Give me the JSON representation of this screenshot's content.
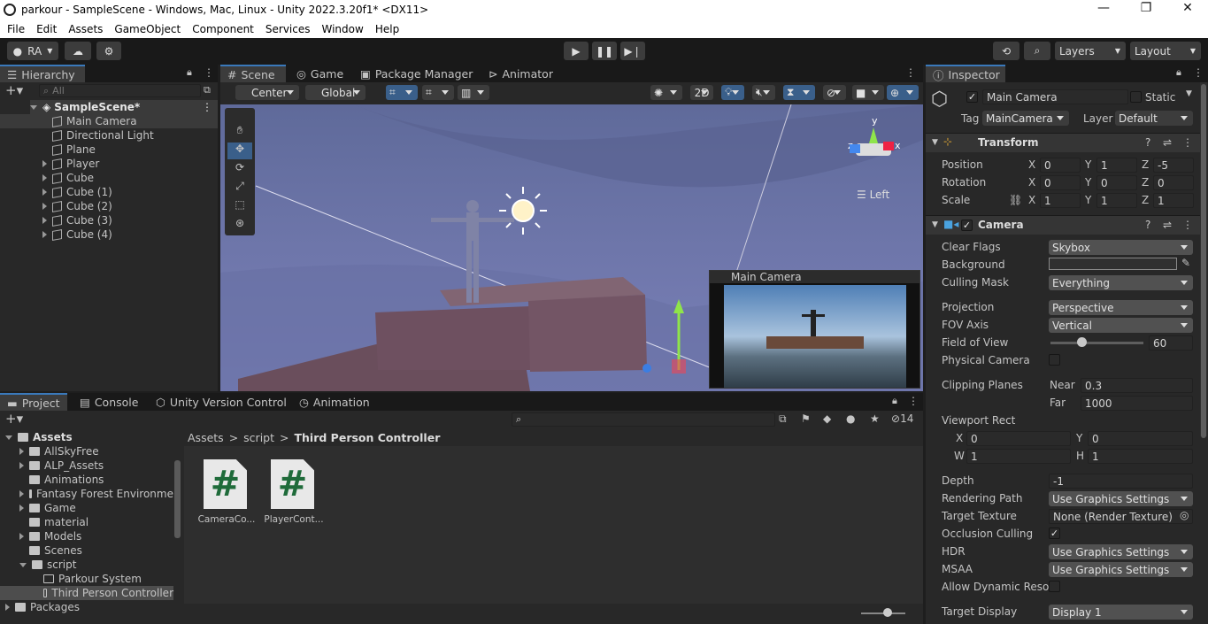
{
  "title": "parkour - SampleScene - Windows, Mac, Linux - Unity 2022.3.20f1* <DX11>",
  "window_controls": [
    "—",
    "❐",
    "✕"
  ],
  "menu": [
    "File",
    "Edit",
    "Assets",
    "GameObject",
    "Component",
    "Services",
    "Window",
    "Help"
  ],
  "toolbar": {
    "account": "RA",
    "layers": "Layers",
    "layout": "Layout"
  },
  "hierarchy": {
    "tab": "Hierarchy",
    "search_placeholder": "All",
    "scene": "SampleScene*",
    "items": [
      "Main Camera",
      "Directional Light",
      "Plane",
      "Player",
      "Cube",
      "Cube (1)",
      "Cube (2)",
      "Cube (3)",
      "Cube (4)"
    ]
  },
  "scene_tabs": [
    "Scene",
    "Game",
    "Package Manager",
    "Animator"
  ],
  "scene_toolbar": {
    "pivot": "Center",
    "space": "Global",
    "mode2d": "2D"
  },
  "gizmo": {
    "y": "y",
    "z": "z",
    "x": "x",
    "view": "Left"
  },
  "camera_preview": {
    "title": "Main Camera"
  },
  "bottom_tabs": [
    "Project",
    "Console",
    "Unity Version Control",
    "Animation"
  ],
  "project": {
    "count": "14",
    "tree": [
      {
        "label": "Assets",
        "level": 0,
        "open": true,
        "bold": true
      },
      {
        "label": "AllSkyFree",
        "level": 1
      },
      {
        "label": "ALP_Assets",
        "level": 1
      },
      {
        "label": "Animations",
        "level": 1,
        "noarrow": true
      },
      {
        "label": "Fantasy Forest Environme",
        "level": 1
      },
      {
        "label": "Game",
        "level": 1
      },
      {
        "label": "material",
        "level": 1,
        "noarrow": true
      },
      {
        "label": "Models",
        "level": 1
      },
      {
        "label": "Scenes",
        "level": 1,
        "noarrow": true
      },
      {
        "label": "script",
        "level": 1,
        "open": true
      },
      {
        "label": "Parkour System",
        "level": 2,
        "noarrow": true
      },
      {
        "label": "Third Person Controller",
        "level": 2,
        "noarrow": true,
        "selected": true
      },
      {
        "label": "Packages",
        "level": 0
      }
    ],
    "breadcrumb": [
      "Assets",
      "script",
      "Third Person Controller"
    ],
    "files": [
      {
        "name": "CameraCo...",
        "glyph": "#"
      },
      {
        "name": "PlayerCont...",
        "glyph": "#"
      }
    ]
  },
  "inspector": {
    "tab": "Inspector",
    "object_name": "Main Camera",
    "static_label": "Static",
    "tag_label": "Tag",
    "tag": "MainCamera",
    "layer_label": "Layer",
    "layer": "Default",
    "transform": {
      "title": "Transform",
      "position": {
        "label": "Position",
        "x": "0",
        "y": "1",
        "z": "-5"
      },
      "rotation": {
        "label": "Rotation",
        "x": "0",
        "y": "0",
        "z": "0"
      },
      "scale": {
        "label": "Scale",
        "x": "1",
        "y": "1",
        "z": "1"
      }
    },
    "camera": {
      "title": "Camera",
      "clear_flags": {
        "label": "Clear Flags",
        "value": "Skybox"
      },
      "background": {
        "label": "Background"
      },
      "culling_mask": {
        "label": "Culling Mask",
        "value": "Everything"
      },
      "projection": {
        "label": "Projection",
        "value": "Perspective"
      },
      "fov_axis": {
        "label": "FOV Axis",
        "value": "Vertical"
      },
      "fov": {
        "label": "Field of View",
        "value": "60",
        "fraction": 0.33
      },
      "physical": {
        "label": "Physical Camera"
      },
      "clipping": {
        "label": "Clipping Planes",
        "near_label": "Near",
        "near": "0.3",
        "far_label": "Far",
        "far": "1000"
      },
      "viewport": {
        "label": "Viewport Rect",
        "x": "0",
        "y": "0",
        "w": "1",
        "h": "1"
      },
      "depth": {
        "label": "Depth",
        "value": "-1"
      },
      "rendering_path": {
        "label": "Rendering Path",
        "value": "Use Graphics Settings"
      },
      "target_texture": {
        "label": "Target Texture",
        "value": "None (Render Texture)"
      },
      "occlusion": {
        "label": "Occlusion Culling"
      },
      "hdr": {
        "label": "HDR",
        "value": "Use Graphics Settings"
      },
      "msaa": {
        "label": "MSAA",
        "value": "Use Graphics Settings"
      },
      "dynres": {
        "label": "Allow Dynamic Resol"
      },
      "target_display": {
        "label": "Target Display",
        "value": "Display 1"
      }
    },
    "axis": {
      "x": "X",
      "y": "Y",
      "z": "Z",
      "w": "W",
      "h": "H"
    }
  }
}
